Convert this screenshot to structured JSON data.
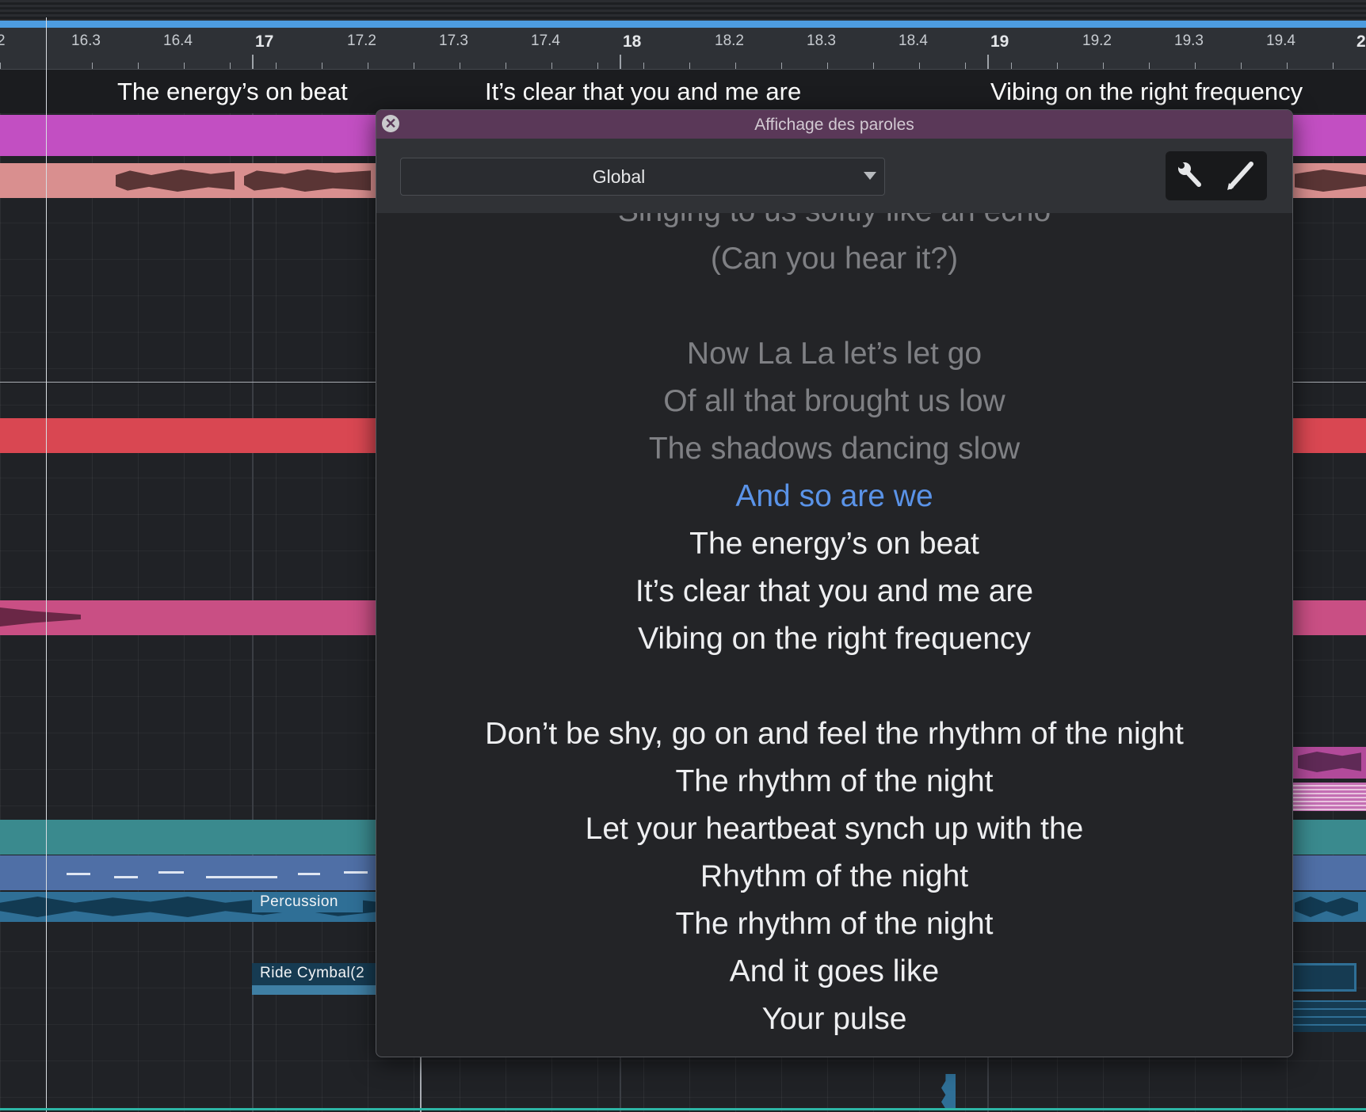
{
  "ruler": {
    "labels": [
      "2",
      "16.3",
      "16.4",
      "17",
      "17.2",
      "17.3",
      "17.4",
      "18",
      "18.2",
      "18.3",
      "18.4",
      "19",
      "19.2",
      "19.3",
      "19.4",
      "2"
    ]
  },
  "lyric_strip": {
    "segments": [
      "The energy’s on beat",
      "It’s clear that you and me are",
      "Vibing on the right frequency"
    ]
  },
  "tracks": {
    "percussion_label": "Percussion",
    "ride_cymbal_label": "Ride Cymbal(2"
  },
  "colors": {
    "loop_bar": "#4d9ce0",
    "magenta_clip": "#c24fc2",
    "salmon_clip": "#d98f8f",
    "red_clip": "#d94752",
    "pink_clip": "#c94f84",
    "teal_clip": "#3a8a8e",
    "blue_clip": "#4f6fa6",
    "percussion_clip": "#2f6f96",
    "current_lyric": "#5a93e8",
    "window_title_bar": "#5a3858"
  },
  "lyrics_window": {
    "title": "Affichage des paroles",
    "close_icon": "close-circle-icon",
    "select_value": "Global",
    "tools": [
      "wrench-icon",
      "pencil-icon"
    ],
    "lines": [
      {
        "text": "Singing to us softly like an echo",
        "state": "past"
      },
      {
        "text": "(Can you hear it?)",
        "state": "past"
      },
      {
        "text": "",
        "state": "past"
      },
      {
        "text": "Now La La let’s let go",
        "state": "past"
      },
      {
        "text": "Of all that brought us low",
        "state": "past"
      },
      {
        "text": "The shadows dancing slow",
        "state": "past"
      },
      {
        "text": "And so are we",
        "state": "current"
      },
      {
        "text": "The energy’s on beat",
        "state": "future"
      },
      {
        "text": "It’s clear that you and me are",
        "state": "future"
      },
      {
        "text": "Vibing on the right frequency",
        "state": "future"
      },
      {
        "text": "",
        "state": "future"
      },
      {
        "text": "Don’t be shy, go on and feel the rhythm of the night",
        "state": "future"
      },
      {
        "text": "The rhythm of the night",
        "state": "future"
      },
      {
        "text": "Let your heartbeat synch up with the",
        "state": "future"
      },
      {
        "text": "Rhythm of the night",
        "state": "future"
      },
      {
        "text": "The rhythm of the night",
        "state": "future"
      },
      {
        "text": "And it goes like",
        "state": "future"
      },
      {
        "text": "Your pulse",
        "state": "future"
      }
    ]
  }
}
